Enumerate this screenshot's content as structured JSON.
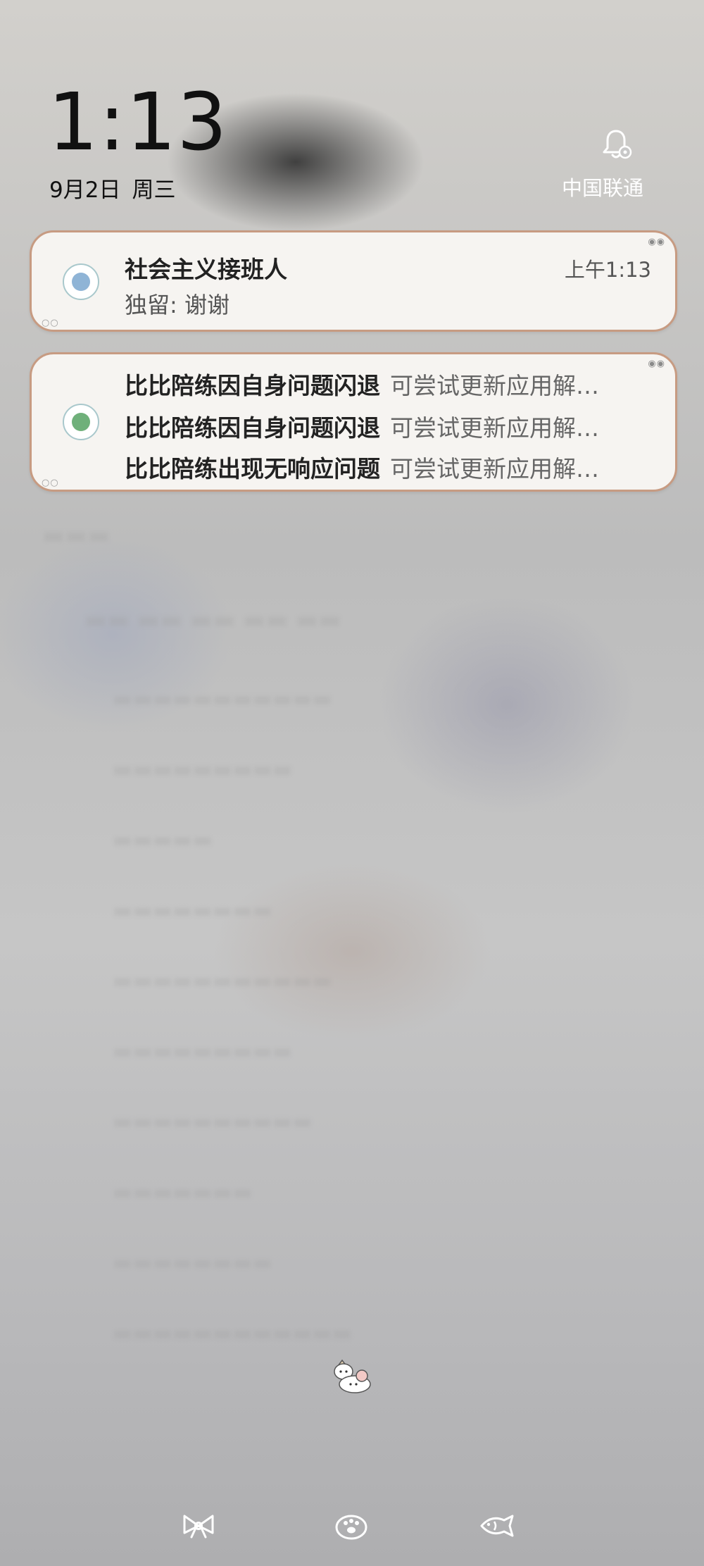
{
  "lockscreen": {
    "time": "1:13",
    "date": {
      "day": "9月2日",
      "weekday": "周三"
    },
    "carrier": "中国联通"
  },
  "notifications": [
    {
      "title": "社会主义接班人",
      "time": "上午1:13",
      "message": "独留: 谢谢"
    },
    {
      "lines": [
        {
          "title": "比比陪练因自身问题闪退",
          "message": "可尝试更新应用解…"
        },
        {
          "title": "比比陪练因自身问题闪退",
          "message": "可尝试更新应用解…"
        },
        {
          "title": "比比陪练出现无响应问题",
          "message": "可尝试更新应用解…"
        }
      ]
    }
  ],
  "icons": {
    "bell": "bell-settings-icon",
    "bottom_left": "bow-icon",
    "bottom_center": "paw-icon",
    "bottom_right": "fish-icon",
    "sticker": "cat-sticker-icon"
  },
  "colors": {
    "card_bg": "#f6f4f1",
    "card_border": "#c79b82",
    "clock_text": "#111111",
    "carrier_text": "#ffffff"
  }
}
